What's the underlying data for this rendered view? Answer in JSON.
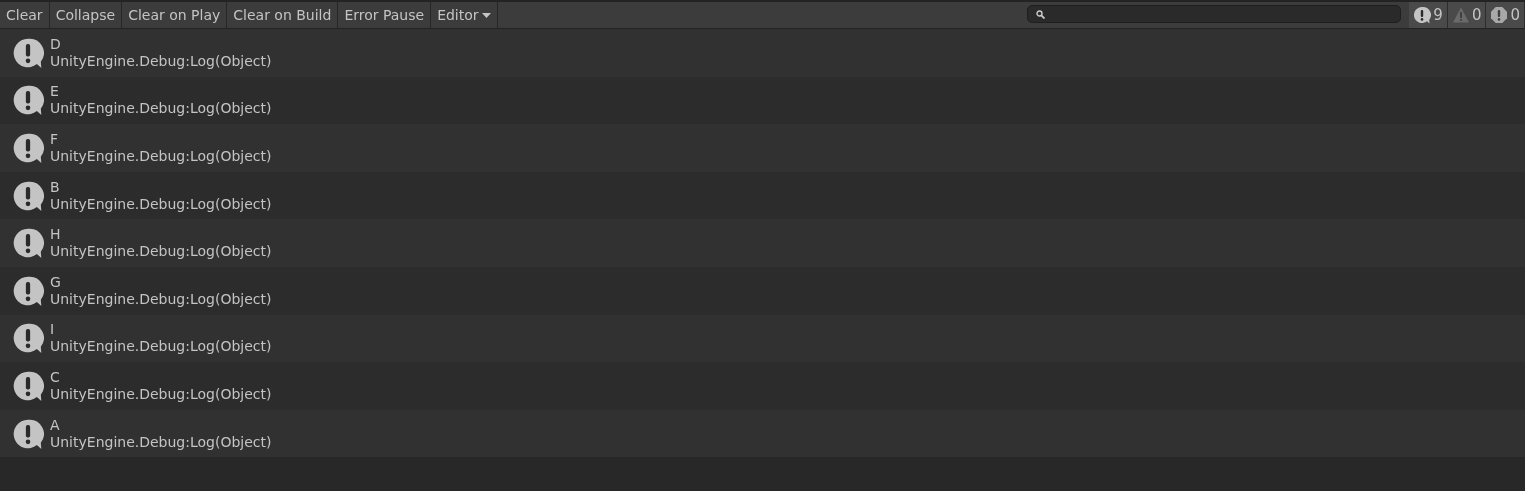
{
  "toolbar": {
    "buttons": [
      {
        "label": "Clear",
        "kind": "button"
      },
      {
        "label": "Collapse",
        "kind": "button"
      },
      {
        "label": "Clear on Play",
        "kind": "button"
      },
      {
        "label": "Clear on Build",
        "kind": "button"
      },
      {
        "label": "Error Pause",
        "kind": "button"
      },
      {
        "label": "Editor",
        "kind": "dropdown"
      }
    ],
    "counters": [
      {
        "kind": "info",
        "count": "9"
      },
      {
        "kind": "warning",
        "count": "0"
      },
      {
        "kind": "error",
        "count": "0"
      }
    ]
  },
  "log": [
    {
      "message": "D",
      "trace": "UnityEngine.Debug:Log(Object)"
    },
    {
      "message": "E",
      "trace": "UnityEngine.Debug:Log(Object)"
    },
    {
      "message": "F",
      "trace": "UnityEngine.Debug:Log(Object)"
    },
    {
      "message": "B",
      "trace": "UnityEngine.Debug:Log(Object)"
    },
    {
      "message": "H",
      "trace": "UnityEngine.Debug:Log(Object)"
    },
    {
      "message": "G",
      "trace": "UnityEngine.Debug:Log(Object)"
    },
    {
      "message": "I",
      "trace": "UnityEngine.Debug:Log(Object)"
    },
    {
      "message": "C",
      "trace": "UnityEngine.Debug:Log(Object)"
    },
    {
      "message": "A",
      "trace": "UnityEngine.Debug:Log(Object)"
    }
  ]
}
